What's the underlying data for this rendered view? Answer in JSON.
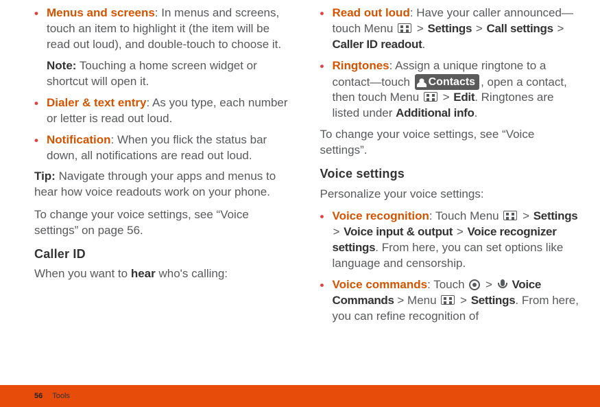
{
  "left": {
    "items": [
      {
        "title": "Menus and screens",
        "body": ": In menus and screens, touch an item to highlight it (the item will be read out loud), and double-touch to choose it.",
        "note_label": "Note:",
        "note_body": " Touching a home screen widget or shortcut will open it."
      },
      {
        "title": "Dialer & text entry",
        "body": ": As you type, each number or letter is read out loud."
      },
      {
        "title": "Notification",
        "body": ": When you flick the status bar down, all notifications are read out loud."
      }
    ],
    "tip_label": "Tip:",
    "tip_body": " Navigate through your apps and menus to hear how voice readouts work on your phone.",
    "change_text": "To change your voice settings, see “Voice settings” on page 56.",
    "caller_id_heading": "Caller ID",
    "caller_intro_a": "When you want to ",
    "caller_intro_bold": "hear",
    "caller_intro_b": " who's calling:"
  },
  "right": {
    "readout": {
      "title": "Read out loud",
      "pre": ": Have your caller announced—touch Menu ",
      "settings": "Settings",
      "callsettings": "Call settings",
      "callerid": "Caller ID readout"
    },
    "ringtones": {
      "title": "Ringtones",
      "pre": ": Assign a unique ringtone to a contact—touch ",
      "contacts": "Contacts",
      "mid": ", open a contact, then touch Menu ",
      "edit": "Edit",
      "tail": ". Ringtones are listed under ",
      "addl": "Additional info"
    },
    "change_text": "To change your voice settings, see “Voice settings”.",
    "voice_heading": "Voice settings",
    "voice_intro": "Personalize your voice settings:",
    "voice_rec": {
      "title": "Voice recognition",
      "pre": ": Touch Menu ",
      "settings": "Settings",
      "vio": "Voice input & output",
      "vrs": "Voice recognizer settings",
      "tail": ". From here, you can set options like language and censorship."
    },
    "voice_cmd": {
      "title": "Voice commands",
      "pre": ": Touch ",
      "voicecmds": "Voice Commands",
      "mid": " > Menu ",
      "settings": "Settings",
      "tail": ". From here, you can refine recognition of"
    }
  },
  "footer": {
    "page": "56",
    "section": "Tools"
  },
  "gt": ">"
}
